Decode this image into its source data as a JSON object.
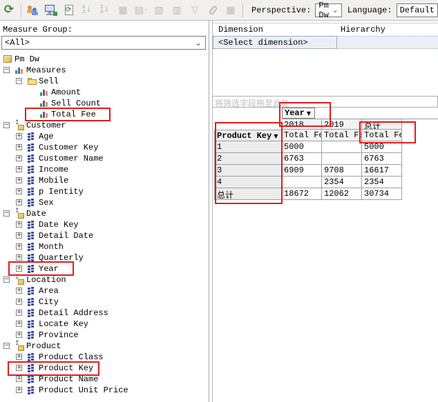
{
  "toolbar": {
    "icons": [
      {
        "name": "reconnect-icon",
        "enabled": true
      },
      {
        "name": "separator",
        "enabled": false
      },
      {
        "name": "users-icon",
        "enabled": true
      },
      {
        "name": "process-icon",
        "enabled": true
      },
      {
        "name": "refresh-icon",
        "enabled": true
      },
      {
        "name": "sort-ascending-icon",
        "enabled": false
      },
      {
        "name": "sort-descending-icon",
        "enabled": false
      },
      {
        "name": "drillthrough-icon",
        "enabled": false
      },
      {
        "name": "show-empty-cells-icon",
        "enabled": false
      },
      {
        "name": "writeback-icon",
        "enabled": false
      },
      {
        "name": "dataset-icon",
        "enabled": false
      },
      {
        "name": "filter-icon",
        "enabled": false
      },
      {
        "name": "attachment-icon",
        "enabled": false
      },
      {
        "name": "chart-icon",
        "enabled": false
      },
      {
        "name": "separator",
        "enabled": false
      }
    ],
    "perspective_label": "Perspective:",
    "perspective_value": "Pm Dw",
    "language_label": "Language:",
    "language_value": "Default"
  },
  "measure_group": {
    "label": "Measure Group:",
    "value": "<All>"
  },
  "tree": {
    "items": [
      {
        "label": "Pm Dw",
        "level": 0,
        "icon": "cube",
        "expand": null,
        "root": true
      },
      {
        "label": "Measures",
        "level": 0,
        "icon": "measure",
        "expand": "minus"
      },
      {
        "label": "Sell",
        "level": 1,
        "icon": "folder",
        "expand": "minus"
      },
      {
        "label": "Amount",
        "level": 2,
        "icon": "measure",
        "expand": null
      },
      {
        "label": "Sell Count",
        "level": 2,
        "icon": "measure",
        "expand": null
      },
      {
        "label": "Total Fee",
        "level": 2,
        "icon": "measure",
        "expand": null
      },
      {
        "label": "Customer",
        "level": 0,
        "icon": "dimension",
        "expand": "minus"
      },
      {
        "label": "Age",
        "level": 1,
        "icon": "attribute",
        "expand": "plus"
      },
      {
        "label": "Customer Key",
        "level": 1,
        "icon": "attribute",
        "expand": "plus"
      },
      {
        "label": "Customer Name",
        "level": 1,
        "icon": "attribute",
        "expand": "plus"
      },
      {
        "label": "Income",
        "level": 1,
        "icon": "attribute",
        "expand": "plus"
      },
      {
        "label": "Mobile",
        "level": 1,
        "icon": "attribute",
        "expand": "plus"
      },
      {
        "label": "p Ientity",
        "level": 1,
        "icon": "attribute",
        "expand": "plus"
      },
      {
        "label": "Sex",
        "level": 1,
        "icon": "attribute",
        "expand": "plus"
      },
      {
        "label": "Date",
        "level": 0,
        "icon": "dimension",
        "expand": "minus"
      },
      {
        "label": "Date Key",
        "level": 1,
        "icon": "attribute",
        "expand": "plus"
      },
      {
        "label": "Detail Date",
        "level": 1,
        "icon": "attribute",
        "expand": "plus"
      },
      {
        "label": "Month",
        "level": 1,
        "icon": "attribute",
        "expand": "plus"
      },
      {
        "label": "Quarterly",
        "level": 1,
        "icon": "attribute",
        "expand": "plus"
      },
      {
        "label": "Year",
        "level": 1,
        "icon": "attribute",
        "expand": "plus"
      },
      {
        "label": "Location",
        "level": 0,
        "icon": "dimension",
        "expand": "minus"
      },
      {
        "label": "Area",
        "level": 1,
        "icon": "attribute",
        "expand": "plus"
      },
      {
        "label": "City",
        "level": 1,
        "icon": "attribute",
        "expand": "plus"
      },
      {
        "label": "Detail Address",
        "level": 1,
        "icon": "attribute",
        "expand": "plus"
      },
      {
        "label": "Locate Key",
        "level": 1,
        "icon": "attribute",
        "expand": "plus"
      },
      {
        "label": "Province",
        "level": 1,
        "icon": "attribute",
        "expand": "plus"
      },
      {
        "label": "Product",
        "level": 0,
        "icon": "dimension",
        "expand": "minus"
      },
      {
        "label": "Product Class",
        "level": 1,
        "icon": "attribute",
        "expand": "plus"
      },
      {
        "label": "Product Key",
        "level": 1,
        "icon": "attribute",
        "expand": "plus"
      },
      {
        "label": "Product Name",
        "level": 1,
        "icon": "attribute",
        "expand": "plus"
      },
      {
        "label": "Product Unit Price",
        "level": 1,
        "icon": "attribute",
        "expand": "plus"
      }
    ]
  },
  "dimension_grid": {
    "columns": [
      "Dimension",
      "Hierarchy"
    ],
    "selected_row": {
      "dimension": "<Select dimension>",
      "hierarchy": ""
    }
  },
  "pivot": {
    "filter_hint": "将筛选字段拖至此处",
    "column_field": "Year",
    "row_field": "Product Key",
    "column_members": [
      "2018",
      "2019",
      "总计"
    ],
    "measure_header": "Total Fee",
    "row_keys": [
      "1",
      "2",
      "3",
      "4",
      "总计"
    ],
    "values": [
      [
        "5000",
        "",
        "5000"
      ],
      [
        "6763",
        "",
        "6763"
      ],
      [
        "6909",
        "9708",
        "16617"
      ],
      [
        "",
        "2354",
        "2354"
      ],
      [
        "18672",
        "12062",
        "30734"
      ]
    ]
  },
  "annotation_color": "#e01b1b"
}
